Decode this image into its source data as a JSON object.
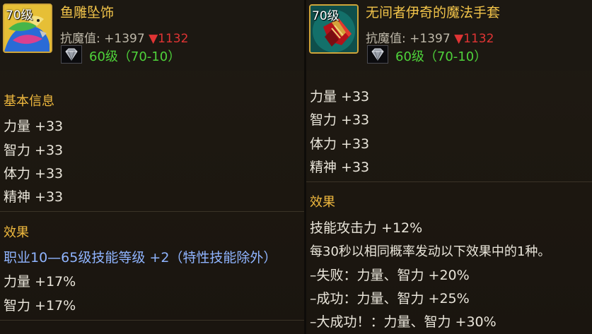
{
  "left": {
    "level_badge": "70级",
    "name": "鱼雕坠饰",
    "magic_resist": {
      "label": "抗魔值:",
      "value": "+1397",
      "down_arrow": "▼",
      "down_value": "1132"
    },
    "requirement": "60级（70-10）",
    "basic_section_title": "基本信息",
    "stats": [
      "力量 +33",
      "智力 +33",
      "体力 +33",
      "精神 +33"
    ],
    "effect_title": "效果",
    "effect_skill_line": "职业10—65级技能等级 +2（特性技能除外）",
    "effect_lines": [
      "力量 +17%",
      "智力 +17%"
    ]
  },
  "right": {
    "level_badge": "70级",
    "name": "无间者伊奇的魔法手套",
    "magic_resist": {
      "label": "抗魔值:",
      "value": "+1397",
      "down_arrow": "▼",
      "down_value": "1132"
    },
    "requirement": "60级（70-10）",
    "stats": [
      "力量 +33",
      "智力 +33",
      "体力 +33",
      "精神 +33"
    ],
    "effect_title": "效果",
    "effect_lines": [
      "技能攻击力 +12%",
      "每30秒以相同概率发动以下效果中的1种。",
      "–失败：力量、智力 +20%",
      "–成功：力量、智力 +25%",
      "–大成功！：力量、智力 +30%"
    ]
  },
  "colors": {
    "name_gold": "#f2c44a",
    "section_gold": "#f0b93e",
    "requirement_green": "#4ed23a",
    "down_red": "#e03434",
    "skill_blue": "#8fb4ff"
  },
  "icons": {
    "left_item": "fish-carving-pendant-icon",
    "right_item": "red-magic-glove-icon",
    "gem": "diamond-gem-icon"
  }
}
